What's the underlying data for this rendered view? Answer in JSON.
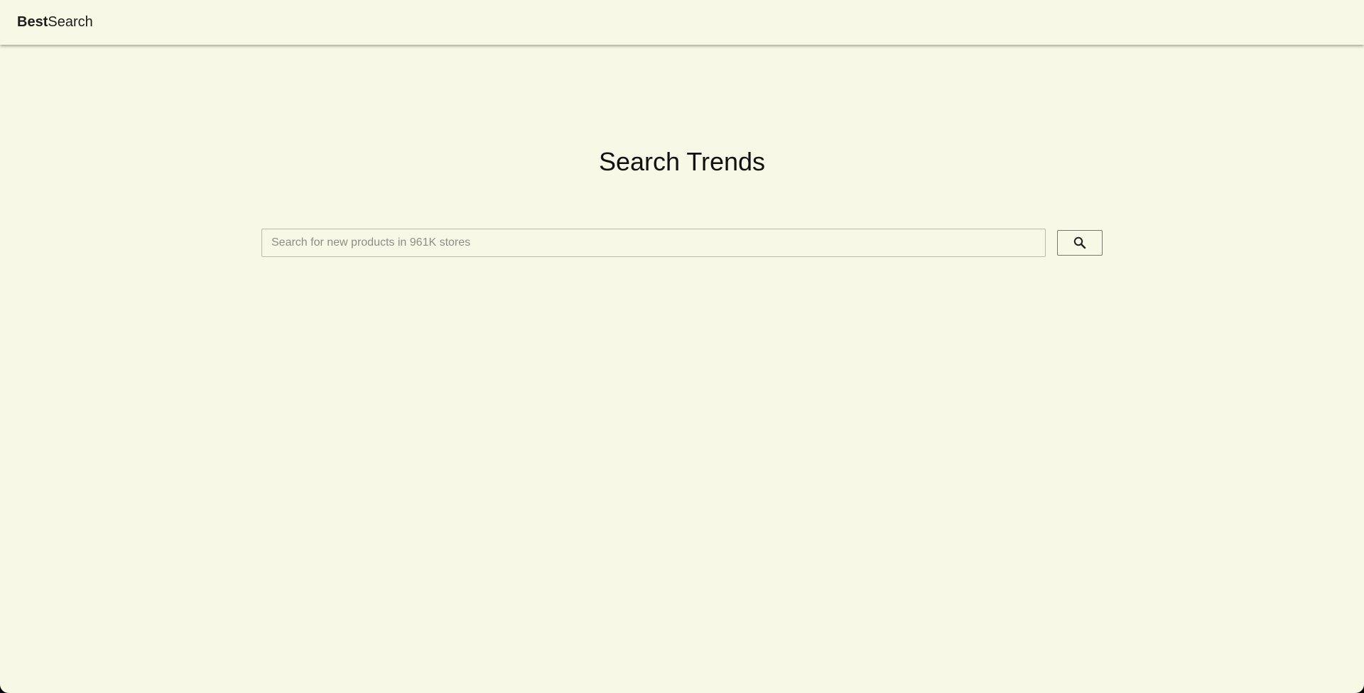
{
  "header": {
    "brand_bold": "Best",
    "brand_regular": "Search"
  },
  "main": {
    "title": "Search Trends",
    "search": {
      "placeholder": "Search for new products in 961K stores",
      "value": "",
      "button_icon": "search-icon"
    }
  },
  "colors": {
    "background": "#f7f9e6",
    "text": "#111111",
    "input_border": "#b9b9b0",
    "button_border": "#777770"
  }
}
